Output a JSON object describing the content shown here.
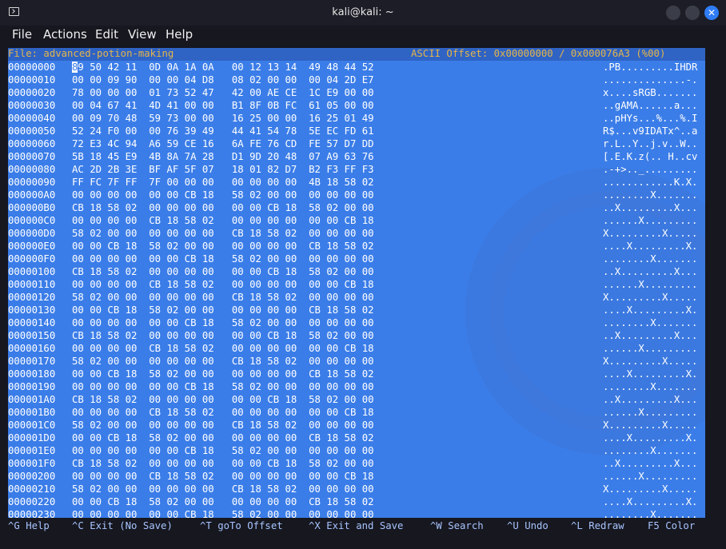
{
  "window": {
    "title": "kali@kali: ~"
  },
  "menu": [
    "File",
    "Actions",
    "Edit",
    "View",
    "Help"
  ],
  "header": {
    "file_label": "File: advanced-potion-making",
    "offset_label": "ASCII Offset: 0x00000000 / 0x000076A3 (%00)"
  },
  "cursor_char": "8",
  "rows": [
    {
      "off": "00000000",
      "hex": "9 50 42 11  0D 0A 1A 0A   00 12 13 14  49 48 44 52",
      "asc": ".PB.........IHDR"
    },
    {
      "off": "00000010",
      "hex": "00 00 09 90  00 00 04 D8   08 02 00 00  00 04 2D E7",
      "asc": "..............-."
    },
    {
      "off": "00000020",
      "hex": "78 00 00 00  01 73 52 47   42 00 AE CE  1C E9 00 00",
      "asc": "x....sRGB......."
    },
    {
      "off": "00000030",
      "hex": "00 04 67 41  4D 41 00 00   B1 8F 0B FC  61 05 00 00",
      "asc": "..gAMA......a..."
    },
    {
      "off": "00000040",
      "hex": "00 09 70 48  59 73 00 00   16 25 00 00  16 25 01 49",
      "asc": "..pHYs...%...%.I"
    },
    {
      "off": "00000050",
      "hex": "52 24 F0 00  00 76 39 49   44 41 54 78  5E EC FD 61",
      "asc": "R$...v9IDATx^..a"
    },
    {
      "off": "00000060",
      "hex": "72 E3 4C 94  A6 59 CE 16   6A FE 76 CD  FE 57 D7 DD",
      "asc": "r.L..Y..j.v..W.."
    },
    {
      "off": "00000070",
      "hex": "5B 18 45 E9  4B 8A 7A 28   D1 9D 20 48  07 A9 63 76",
      "asc": "[.E.K.z(.. H..cv"
    },
    {
      "off": "00000080",
      "hex": "AC 2D 2B 3E  BF AF 5F 07   18 01 82 D7  B2 F3 FF F3",
      "asc": ".-+>.._........."
    },
    {
      "off": "00000090",
      "hex": "FF FC 7F FF  7F 00 00 00   00 00 00 00  4B 18 58 02",
      "asc": "............K.X."
    },
    {
      "off": "000000A0",
      "hex": "00 00 00 00  00 00 CB 18   58 02 00 00  00 00 00 00",
      "asc": "........X......."
    },
    {
      "off": "000000B0",
      "hex": "CB 18 58 02  00 00 00 00   00 00 CB 18  58 02 00 00",
      "asc": "..X.........X..."
    },
    {
      "off": "000000C0",
      "hex": "00 00 00 00  CB 18 58 02   00 00 00 00  00 00 CB 18",
      "asc": "......X........."
    },
    {
      "off": "000000D0",
      "hex": "58 02 00 00  00 00 00 00   CB 18 58 02  00 00 00 00",
      "asc": "X.........X....."
    },
    {
      "off": "000000E0",
      "hex": "00 00 CB 18  58 02 00 00   00 00 00 00  CB 18 58 02",
      "asc": "....X.........X."
    },
    {
      "off": "000000F0",
      "hex": "00 00 00 00  00 00 CB 18   58 02 00 00  00 00 00 00",
      "asc": "........X......."
    },
    {
      "off": "00000100",
      "hex": "CB 18 58 02  00 00 00 00   00 00 CB 18  58 02 00 00",
      "asc": "..X.........X..."
    },
    {
      "off": "00000110",
      "hex": "00 00 00 00  CB 18 58 02   00 00 00 00  00 00 CB 18",
      "asc": "......X........."
    },
    {
      "off": "00000120",
      "hex": "58 02 00 00  00 00 00 00   CB 18 58 02  00 00 00 00",
      "asc": "X.........X....."
    },
    {
      "off": "00000130",
      "hex": "00 00 CB 18  58 02 00 00   00 00 00 00  CB 18 58 02",
      "asc": "....X.........X."
    },
    {
      "off": "00000140",
      "hex": "00 00 00 00  00 00 CB 18   58 02 00 00  00 00 00 00",
      "asc": "........X......."
    },
    {
      "off": "00000150",
      "hex": "CB 18 58 02  00 00 00 00   00 00 CB 18  58 02 00 00",
      "asc": "..X.........X..."
    },
    {
      "off": "00000160",
      "hex": "00 00 00 00  CB 18 58 02   00 00 00 00  00 00 CB 18",
      "asc": "......X........."
    },
    {
      "off": "00000170",
      "hex": "58 02 00 00  00 00 00 00   CB 18 58 02  00 00 00 00",
      "asc": "X.........X....."
    },
    {
      "off": "00000180",
      "hex": "00 00 CB 18  58 02 00 00   00 00 00 00  CB 18 58 02",
      "asc": "....X.........X."
    },
    {
      "off": "00000190",
      "hex": "00 00 00 00  00 00 CB 18   58 02 00 00  00 00 00 00",
      "asc": "........X......."
    },
    {
      "off": "000001A0",
      "hex": "CB 18 58 02  00 00 00 00   00 00 CB 18  58 02 00 00",
      "asc": "..X.........X..."
    },
    {
      "off": "000001B0",
      "hex": "00 00 00 00  CB 18 58 02   00 00 00 00  00 00 CB 18",
      "asc": "......X........."
    },
    {
      "off": "000001C0",
      "hex": "58 02 00 00  00 00 00 00   CB 18 58 02  00 00 00 00",
      "asc": "X.........X....."
    },
    {
      "off": "000001D0",
      "hex": "00 00 CB 18  58 02 00 00   00 00 00 00  CB 18 58 02",
      "asc": "....X.........X."
    },
    {
      "off": "000001E0",
      "hex": "00 00 00 00  00 00 CB 18   58 02 00 00  00 00 00 00",
      "asc": "........X......."
    },
    {
      "off": "000001F0",
      "hex": "CB 18 58 02  00 00 00 00   00 00 CB 18  58 02 00 00",
      "asc": "..X.........X..."
    },
    {
      "off": "00000200",
      "hex": "00 00 00 00  CB 18 58 02   00 00 00 00  00 00 CB 18",
      "asc": "......X........."
    },
    {
      "off": "00000210",
      "hex": "58 02 00 00  00 00 00 00   CB 18 58 02  00 00 00 00",
      "asc": "X.........X....."
    },
    {
      "off": "00000220",
      "hex": "00 00 CB 18  58 02 00 00   00 00 00 00  CB 18 58 02",
      "asc": "....X.........X."
    },
    {
      "off": "00000230",
      "hex": "00 00 00 00  00 00 CB 18   58 02 00 00  00 00 00 00",
      "asc": "........X......."
    }
  ],
  "shortcuts": [
    "^G Help",
    "^C Exit (No Save)",
    "^T goTo Offset",
    "^X Exit and Save",
    "^W Search",
    "^U Undo",
    "^L Redraw",
    "F5 Color"
  ],
  "colors": {
    "editor_bg": "#3b7de8",
    "header_text": "#e4b54a",
    "accent": "#2f7cf6"
  }
}
